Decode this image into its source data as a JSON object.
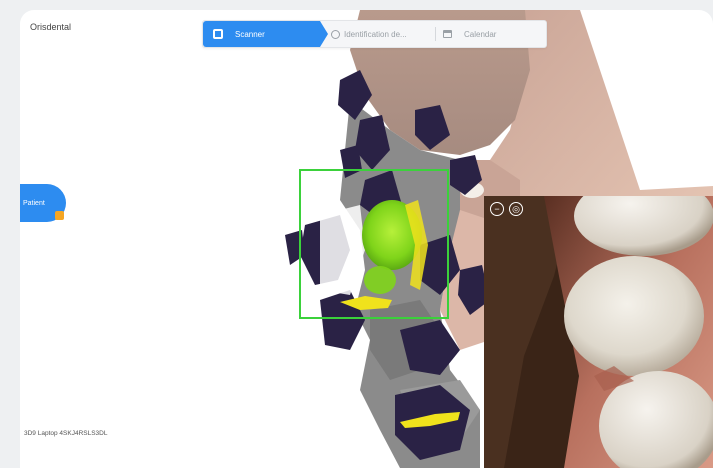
{
  "app": {
    "title": "Orisdental"
  },
  "toolbar": {
    "primary_label": "Scanner",
    "search_placeholder": "Identification de...",
    "calendar_label": "Calendar"
  },
  "side_panel": {
    "label": "Patient"
  },
  "footer": {
    "device_text": "3D9 Laptop 4SKJ4RSLS3DL"
  },
  "colors": {
    "accent": "#2d8cf0",
    "roi_box": "#3bd13b",
    "highlight_green": "#8bdc1e",
    "highlight_yellow": "#f0e21c"
  },
  "inset_controls": [
    {
      "icon": "zoom-out-icon",
      "glyph": "−"
    },
    {
      "icon": "camera-icon",
      "glyph": "◎"
    }
  ]
}
